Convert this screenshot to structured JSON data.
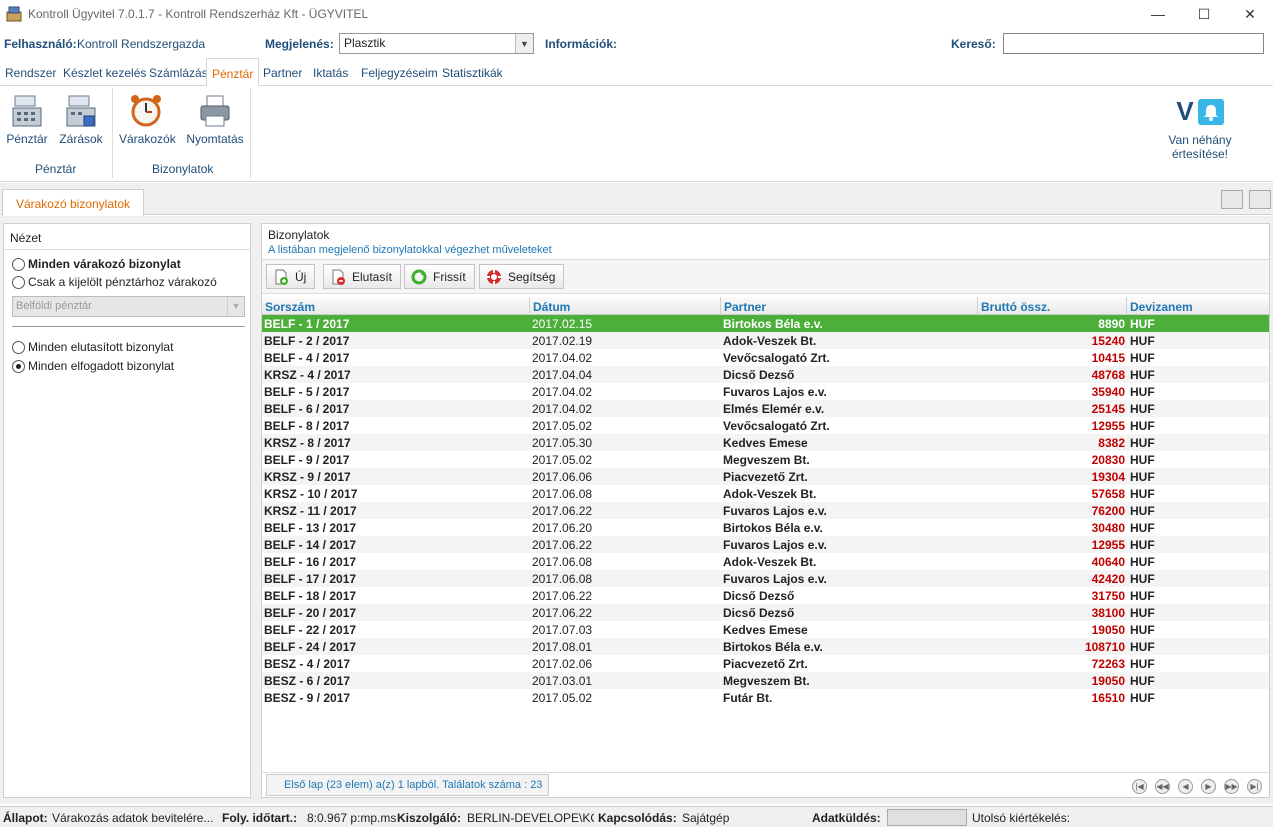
{
  "window": {
    "title": "Kontroll Ügyvitel 7.0.1.7 - Kontroll Rendszerház Kft - ÜGYVITEL",
    "minimize": "—",
    "maximize": "☐",
    "close": "✕"
  },
  "userbar": {
    "user_label": "Felhasználó:",
    "user_value": "Kontroll Rendszergazda",
    "appearance_label": "Megjelenés:",
    "appearance_value": "Plasztik",
    "info_label": "Információk:",
    "search_label": "Kereső:",
    "search_value": ""
  },
  "menu": {
    "tabs": [
      "Rendszer",
      "Készlet kezelés",
      "Számlázás",
      "Pénztár",
      "Partner",
      "Iktatás",
      "Feljegyzéseim",
      "Statisztikák"
    ],
    "active": "Pénztár"
  },
  "ribbon": {
    "buttons": [
      "Pénztár",
      "Zárások",
      "Várakozók",
      "Nyomtatás"
    ],
    "groups": [
      "Pénztár",
      "Bizonylatok"
    ],
    "notification_line1": "Van néhány",
    "notification_line2": "értesítése!",
    "notification_logo": "V"
  },
  "doc_tab": "Várakozó bizonylatok",
  "left": {
    "header": "Nézet",
    "radio_all_waiting": "Minden várakozó bizonylat",
    "radio_selected_cash": "Csak a kijelölt pénztárhoz várakozó",
    "cash_select_value": "Belföldi pénztár",
    "radio_all_rejected": "Minden elutasított bizonylat",
    "radio_all_accepted": "Minden elfogadott bizonylat"
  },
  "right": {
    "title": "Bizonylatok",
    "subtitle": "A listában megjelenő bizonylatokkal végezhet műveleteket",
    "btn_new": "Új",
    "btn_reject": "Elutasít",
    "btn_refresh": "Frissít",
    "btn_help": "Segítség",
    "columns": [
      "Sorszám",
      "Dátum",
      "Partner",
      "Bruttó össz.",
      "Devizanem"
    ],
    "footer_info": "Első lap (23 elem) a(z) 1 lapból. Találatok száma : 23"
  },
  "rows": [
    [
      "BELF - 1 / 2017",
      "2017.02.15",
      "Birtokos Béla e.v.",
      "8890",
      "HUF"
    ],
    [
      "BELF - 2 / 2017",
      "2017.02.19",
      "Adok-Veszek Bt.",
      "15240",
      "HUF"
    ],
    [
      "BELF - 4 / 2017",
      "2017.04.02",
      "Vevőcsalogató Zrt.",
      "10415",
      "HUF"
    ],
    [
      "KRSZ - 4 / 2017",
      "2017.04.04",
      "Dicső Dezső",
      "48768",
      "HUF"
    ],
    [
      "BELF - 5 / 2017",
      "2017.04.02",
      "Fuvaros Lajos e.v.",
      "35940",
      "HUF"
    ],
    [
      "BELF - 6 / 2017",
      "2017.04.02",
      "Elmés Elemér e.v.",
      "25145",
      "HUF"
    ],
    [
      "BELF - 8 / 2017",
      "2017.05.02",
      "Vevőcsalogató Zrt.",
      "12955",
      "HUF"
    ],
    [
      "KRSZ - 8 / 2017",
      "2017.05.30",
      "Kedves Emese",
      "8382",
      "HUF"
    ],
    [
      "BELF - 9 / 2017",
      "2017.05.02",
      "Megveszem Bt.",
      "20830",
      "HUF"
    ],
    [
      "KRSZ - 9 / 2017",
      "2017.06.06",
      "Piacvezető Zrt.",
      "19304",
      "HUF"
    ],
    [
      "KRSZ - 10 / 2017",
      "2017.06.08",
      "Adok-Veszek Bt.",
      "57658",
      "HUF"
    ],
    [
      "KRSZ - 11 / 2017",
      "2017.06.22",
      "Fuvaros Lajos e.v.",
      "76200",
      "HUF"
    ],
    [
      "BELF - 13 / 2017",
      "2017.06.20",
      "Birtokos Béla e.v.",
      "30480",
      "HUF"
    ],
    [
      "BELF - 14 / 2017",
      "2017.06.22",
      "Fuvaros Lajos e.v.",
      "12955",
      "HUF"
    ],
    [
      "BELF - 16 / 2017",
      "2017.06.08",
      "Adok-Veszek Bt.",
      "40640",
      "HUF"
    ],
    [
      "BELF - 17 / 2017",
      "2017.06.08",
      "Fuvaros Lajos e.v.",
      "42420",
      "HUF"
    ],
    [
      "BELF - 18 / 2017",
      "2017.06.22",
      "Dicső Dezső",
      "31750",
      "HUF"
    ],
    [
      "BELF - 20 / 2017",
      "2017.06.22",
      "Dicső Dezső",
      "38100",
      "HUF"
    ],
    [
      "BELF - 22 / 2017",
      "2017.07.03",
      "Kedves Emese",
      "19050",
      "HUF"
    ],
    [
      "BELF - 24 / 2017",
      "2017.08.01",
      "Birtokos Béla e.v.",
      "108710",
      "HUF"
    ],
    [
      "BESZ - 4 / 2017",
      "2017.02.06",
      "Piacvezető Zrt.",
      "72263",
      "HUF"
    ],
    [
      "BESZ - 6 / 2017",
      "2017.03.01",
      "Megveszem Bt.",
      "19050",
      "HUF"
    ],
    [
      "BESZ - 9 / 2017",
      "2017.05.02",
      "Futár Bt.",
      "16510",
      "HUF"
    ]
  ],
  "selected_row": 0,
  "status": {
    "state_label": "Állapot:",
    "state_value": "Várakozás adatok bevitelére...",
    "duration_label": "Foly. időtart.:",
    "duration_value": "8:0.967 p:mp.ms",
    "server_label": "Kiszolgáló:",
    "server_value": "BERLIN-DEVELOPE\\KONTR",
    "connection_label": "Kapcsolódás:",
    "connection_value": "Sajátgép",
    "send_label": "Adatküldés:",
    "last_eval_label": "Utolsó kiértékelés:"
  },
  "colors": {
    "accent": "#1f4e79",
    "active_tab": "#e06a00",
    "selected_row": "#4caf39",
    "amount": "#c00000",
    "link": "#1f77b4"
  }
}
